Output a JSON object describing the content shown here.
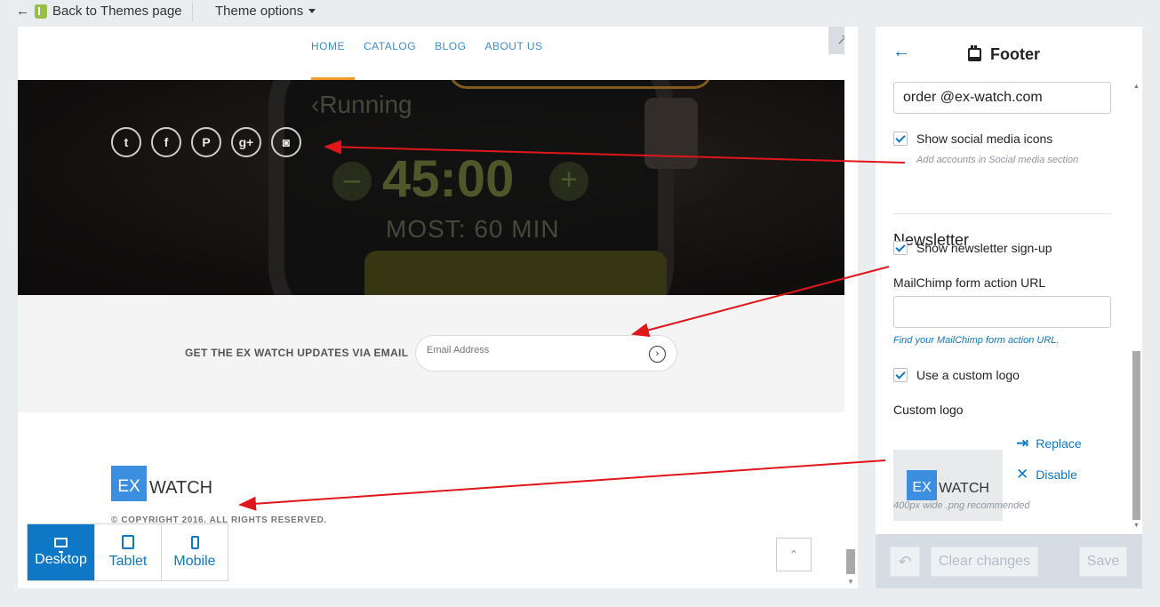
{
  "topbar": {
    "back_label": "Back to Themes page",
    "theme_options_label": "Theme options"
  },
  "preview": {
    "nav": [
      "HOME",
      "CATALOG",
      "BLOG",
      "ABOUT US"
    ],
    "hero": {
      "running": "Running",
      "time": "45:00",
      "most": "MOST: 60 MIN",
      "socials": [
        "twitter-icon",
        "facebook-icon",
        "pinterest-icon",
        "google-plus-icon",
        "instagram-icon"
      ]
    },
    "newsletter": {
      "label": "GET THE EX WATCH UPDATES VIA EMAIL",
      "email_placeholder": "Email Address"
    },
    "footer": {
      "logo_ex": "EX",
      "logo_watch": "WATCH",
      "copyright": "© COPYRIGHT 2016. ALL RIGHTS RESERVED."
    }
  },
  "devices": [
    {
      "label": "Desktop",
      "active": true
    },
    {
      "label": "Tablet",
      "active": false
    },
    {
      "label": "Mobile",
      "active": false
    }
  ],
  "panel": {
    "title": "Footer",
    "email_value": "order @ex-watch.com",
    "show_social_label": "Show social media icons",
    "social_hint": "Add accounts in Social media section",
    "newsletter_title": "Newsletter",
    "show_newsletter_label": "Show newsletter sign-up",
    "mailchimp_label": "MailChimp form action URL",
    "mailchimp_value": "",
    "mailchimp_hint": "Find your MailChimp form action URL.",
    "custom_logo_check_label": "Use a custom logo",
    "custom_logo_label": "Custom logo",
    "logo_ex": "EX",
    "logo_watch": "WATCH",
    "replace_label": "Replace",
    "disable_label": "Disable",
    "logo_hint": "400px wide .png recommended",
    "clear_label": "Clear changes",
    "save_label": "Save"
  },
  "colors": {
    "accent": "#0e78c6",
    "nav_active": "#f09a2a",
    "annotation_arrow": "#e0161b"
  }
}
